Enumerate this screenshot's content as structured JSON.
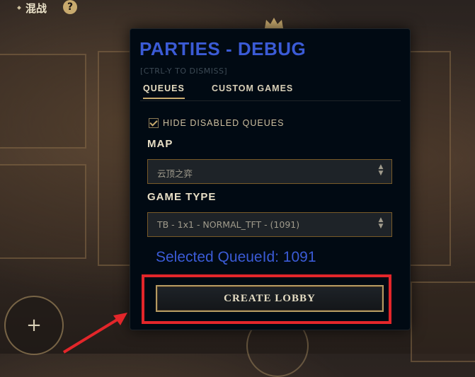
{
  "breadcrumb": {
    "current": "混战",
    "help_icon": "?"
  },
  "modal": {
    "title": "PARTIES - DEBUG",
    "subtitle": "[CTRL-Y TO DISMISS]",
    "tabs": [
      {
        "label": "QUEUES",
        "active": true
      },
      {
        "label": "CUSTOM GAMES",
        "active": false
      }
    ],
    "hide_disabled": {
      "label": "HIDE DISABLED QUEUES",
      "checked": true
    },
    "map": {
      "label": "MAP",
      "value": "云顶之弈"
    },
    "game_type": {
      "label": "GAME TYPE",
      "value": "TB - 1x1 - NORMAL_TFT - (1091)"
    },
    "selected_queue": "Selected QueueId: 1091",
    "create_button": "CREATE LOBBY"
  },
  "background": {
    "plus_icon": "+"
  },
  "colors": {
    "accent_blue": "#3b5bd6",
    "gold": "#c8aa6e",
    "highlight_red": "#e3262a"
  }
}
